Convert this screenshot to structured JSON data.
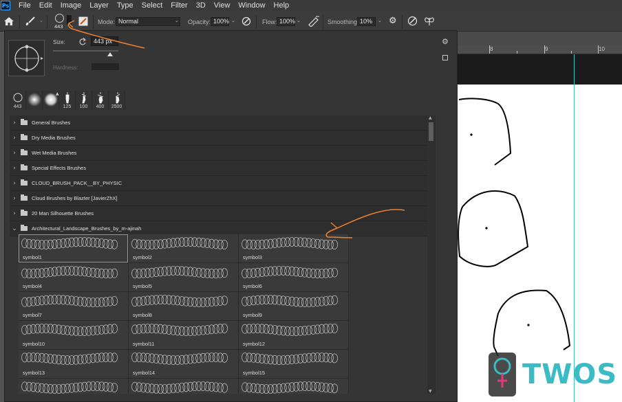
{
  "app": {
    "logo_text": "Ps"
  },
  "menu": [
    "File",
    "Edit",
    "Image",
    "Layer",
    "Type",
    "Select",
    "Filter",
    "3D",
    "View",
    "Window",
    "Help"
  ],
  "options_bar": {
    "brush_size_badge": "443",
    "mode_label": "Mode:",
    "mode_value": "Normal",
    "opacity_label": "Opacity:",
    "opacity_value": "100%",
    "flow_label": "Flow:",
    "flow_value": "100%",
    "smoothing_label": "Smoothing:",
    "smoothing_value": "10%"
  },
  "brush_panel": {
    "size_label": "Size:",
    "size_value": "443 px",
    "hardness_label": "Hardness:",
    "recent_brushes": [
      "443",
      "",
      "",
      "125",
      "100",
      "400",
      "2500"
    ],
    "groups": [
      "General Brushes",
      "Dry Media Brushes",
      "Wet Media Brushes",
      "Special Effects Brushes",
      "CLOUD_BRUSH_PACK__BY_PHYSIC",
      "Cloud Brushes by Blazter [JavierZhX]",
      "20 Man Silhouette Brushes",
      "Architectural_Landscape_Brushes_by_m-ajinah"
    ],
    "brushes": [
      "symbol1",
      "symbol2",
      "symbol3",
      "symbol4",
      "symbol5",
      "symbol6",
      "symbol7",
      "symbol8",
      "symbol9",
      "symbol10",
      "symbol11",
      "symbol12",
      "symbol13",
      "symbol14",
      "symbol15",
      "",
      "",
      ""
    ]
  },
  "ruler": {
    "numbers": [
      "8",
      "9",
      "10"
    ]
  },
  "watermark": {
    "text": "TWOS"
  },
  "colors": {
    "accent_annotation": "#f0822e",
    "guide": "#39c4c9",
    "selection": "#57a9e7"
  }
}
